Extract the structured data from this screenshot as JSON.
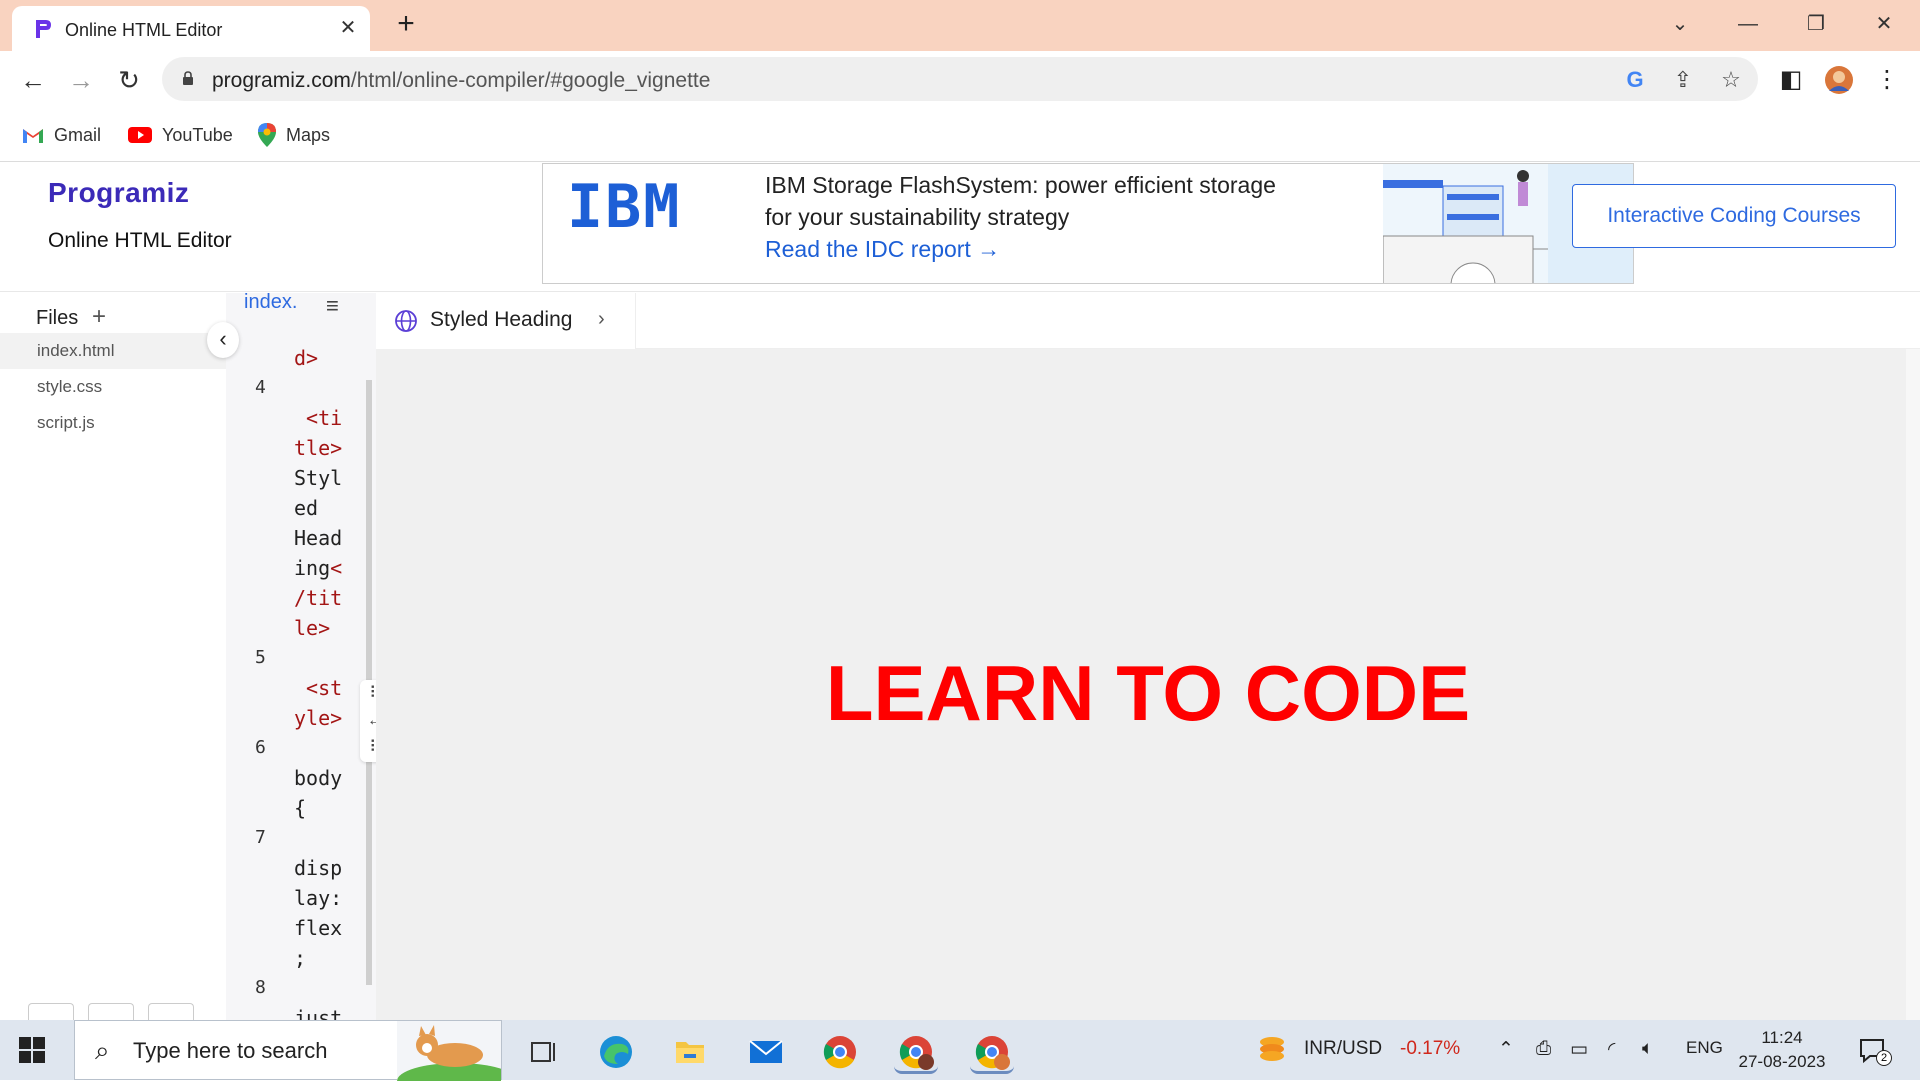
{
  "browser": {
    "tab_title": "Online HTML Editor",
    "url_host": "programiz.com",
    "url_path": "/html/online-compiler/#google_vignette",
    "bookmarks": [
      {
        "label": "Gmail",
        "icon": "gmail-icon"
      },
      {
        "label": "YouTube",
        "icon": "youtube-icon"
      },
      {
        "label": "Maps",
        "icon": "maps-icon"
      }
    ]
  },
  "site": {
    "logo": "Programiz",
    "editor_title": "Online HTML Editor",
    "courses_button": "Interactive Coding Courses",
    "ad": {
      "brand": "IBM",
      "line1": "IBM Storage FlashSystem: power efficient storage",
      "line2": "for your sustainability strategy",
      "cta": "Read the IDC report"
    }
  },
  "files": {
    "heading": "Files",
    "add": "+",
    "items": [
      "index.html",
      "style.css",
      "script.js"
    ]
  },
  "code": {
    "tab": "index.",
    "lines": [
      {
        "no": "",
        "text": "d>",
        "kind": "tag"
      },
      {
        "no": "4",
        "text": "",
        "kind": "plain"
      },
      {
        "no": "",
        "text": " <ti",
        "kind": "tag"
      },
      {
        "no": "",
        "text": "tle>",
        "kind": "tag"
      },
      {
        "no": "",
        "text": "Styl",
        "kind": "plain"
      },
      {
        "no": "",
        "text": "ed",
        "kind": "plain"
      },
      {
        "no": "",
        "text": "Head",
        "kind": "plain"
      },
      {
        "no": "",
        "text": "ing<",
        "kind": "mixed"
      },
      {
        "no": "",
        "text": "/tit",
        "kind": "tag"
      },
      {
        "no": "",
        "text": "le>",
        "kind": "tag"
      },
      {
        "no": "5",
        "text": "",
        "kind": "plain"
      },
      {
        "no": "",
        "text": " <st",
        "kind": "tag"
      },
      {
        "no": "",
        "text": "yle>",
        "kind": "tag"
      },
      {
        "no": "6",
        "text": "",
        "kind": "plain"
      },
      {
        "no": "",
        "text": "body",
        "kind": "plain"
      },
      {
        "no": "",
        "text": "{",
        "kind": "plain"
      },
      {
        "no": "7",
        "text": "",
        "kind": "plain"
      },
      {
        "no": "",
        "text": "disp",
        "kind": "plain"
      },
      {
        "no": "",
        "text": "lay:",
        "kind": "plain"
      },
      {
        "no": "",
        "text": "flex",
        "kind": "plain"
      },
      {
        "no": "",
        "text": ";",
        "kind": "plain"
      },
      {
        "no": "8",
        "text": "",
        "kind": "plain"
      },
      {
        "no": "",
        "text": "just",
        "kind": "plain"
      }
    ]
  },
  "output": {
    "tab_label": "Styled Heading",
    "heading": "LEARN TO CODE",
    "heading_color": "#ff0000"
  },
  "taskbar": {
    "search_placeholder": "Type here to search",
    "ticker_label": "INR/USD",
    "ticker_change": "-0.17%",
    "language": "ENG",
    "time": "11:24",
    "date": "27-08-2023",
    "notifications": "2"
  }
}
